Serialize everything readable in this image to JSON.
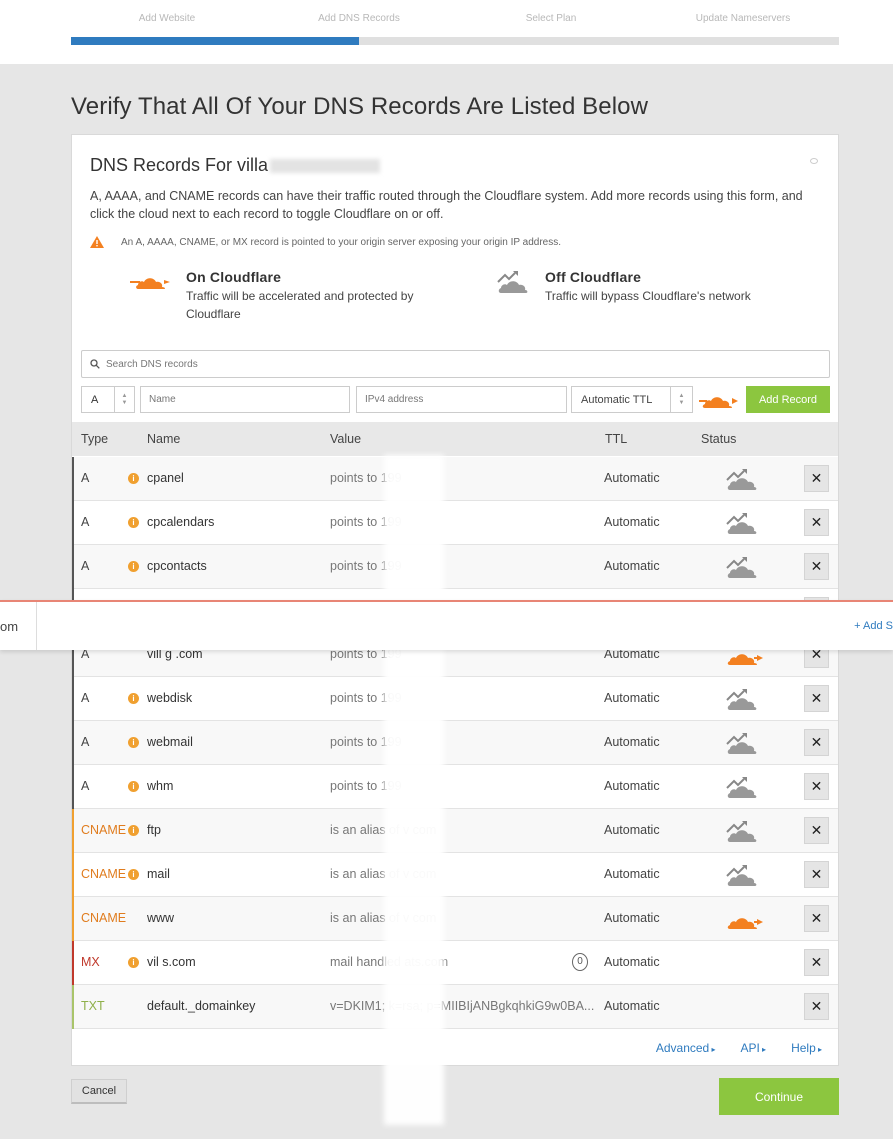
{
  "steps": [
    "Add Website",
    "Add DNS Records",
    "Select Plan",
    "Update Nameservers"
  ],
  "progress_fraction": 0.375,
  "page_title": "Verify That All Of Your DNS Records Are Listed Below",
  "card": {
    "title": "DNS Records For villa",
    "description": "A, AAAA, and CNAME records can have their traffic routed through the Cloudflare system. Add more records using this form, and click the cloud next to each record to toggle Cloudflare on or off.",
    "warning": "An A, AAAA, CNAME, or MX record is pointed to your origin server exposing your origin IP address.",
    "on": {
      "head": "On Cloudflare",
      "sub": "Traffic will be accelerated and protected by Cloudflare"
    },
    "off": {
      "head": "Off Cloudflare",
      "sub": "Traffic will bypass Cloudflare's network"
    }
  },
  "search": {
    "placeholder": "Search DNS records"
  },
  "add_form": {
    "type": "A",
    "name_placeholder": "Name",
    "value_placeholder": "IPv4 address",
    "ttl": "Automatic TTL",
    "add_label": "Add Record"
  },
  "columns": {
    "type": "Type",
    "name": "Name",
    "value": "Value",
    "ttl": "TTL",
    "status": "Status"
  },
  "records": [
    {
      "type": "A",
      "name": "cpanel",
      "value": "points to 199",
      "ttl": "Automatic",
      "cloud": "off",
      "warn": true
    },
    {
      "type": "A",
      "name": "cpcalendars",
      "value": "points to 199",
      "ttl": "Automatic",
      "cloud": "off",
      "warn": true
    },
    {
      "type": "A",
      "name": "cpcontacts",
      "value": "points to 199",
      "ttl": "Automatic",
      "cloud": "off",
      "warn": true
    },
    {
      "type": "",
      "name": "",
      "value": "",
      "ttl": "",
      "cloud": "off",
      "warn": false
    },
    {
      "type": "A",
      "name": "vill  g  .com",
      "value": "points to 199",
      "ttl": "Automatic",
      "cloud": "on",
      "warn": false
    },
    {
      "type": "A",
      "name": "webdisk",
      "value": "points to 199",
      "ttl": "Automatic",
      "cloud": "off",
      "warn": true
    },
    {
      "type": "A",
      "name": "webmail",
      "value": "points to 199",
      "ttl": "Automatic",
      "cloud": "off",
      "warn": true
    },
    {
      "type": "A",
      "name": "whm",
      "value": "points to 199",
      "ttl": "Automatic",
      "cloud": "off",
      "warn": true
    },
    {
      "type": "CNAME",
      "name": "ftp",
      "value": "is an alias of v com",
      "ttl": "Automatic",
      "cloud": "off",
      "warn": true
    },
    {
      "type": "CNAME",
      "name": "mail",
      "value": "is an alias of v com",
      "ttl": "Automatic",
      "cloud": "off",
      "warn": true
    },
    {
      "type": "CNAME",
      "name": "www",
      "value": "is an alias of v com",
      "ttl": "Automatic",
      "cloud": "on",
      "warn": false
    },
    {
      "type": "MX",
      "name": "vil  s.com",
      "value": "mail handled ats.com",
      "ttl": "Automatic",
      "cloud": "none",
      "warn": true,
      "priority": "0"
    },
    {
      "type": "TXT",
      "name": "default._domainkey",
      "value": "v=DKIM1; k=rsa; p=MIIBIjANBgkqhkiG9w0BA...",
      "ttl": "Automatic",
      "cloud": "none",
      "warn": false
    }
  ],
  "footer_links": [
    "Advanced",
    "API",
    "Help"
  ],
  "cancel_label": "Cancel",
  "continue_label": "Continue",
  "overlay": {
    "left_text": "om",
    "right_text": "+ Add S"
  },
  "colors": {
    "accent": "#2f7bbf",
    "green": "#8cc63f",
    "orange": "#f38020",
    "cname": "#e07c1e",
    "mx": "#c0392b",
    "txt": "#8fb04a"
  }
}
